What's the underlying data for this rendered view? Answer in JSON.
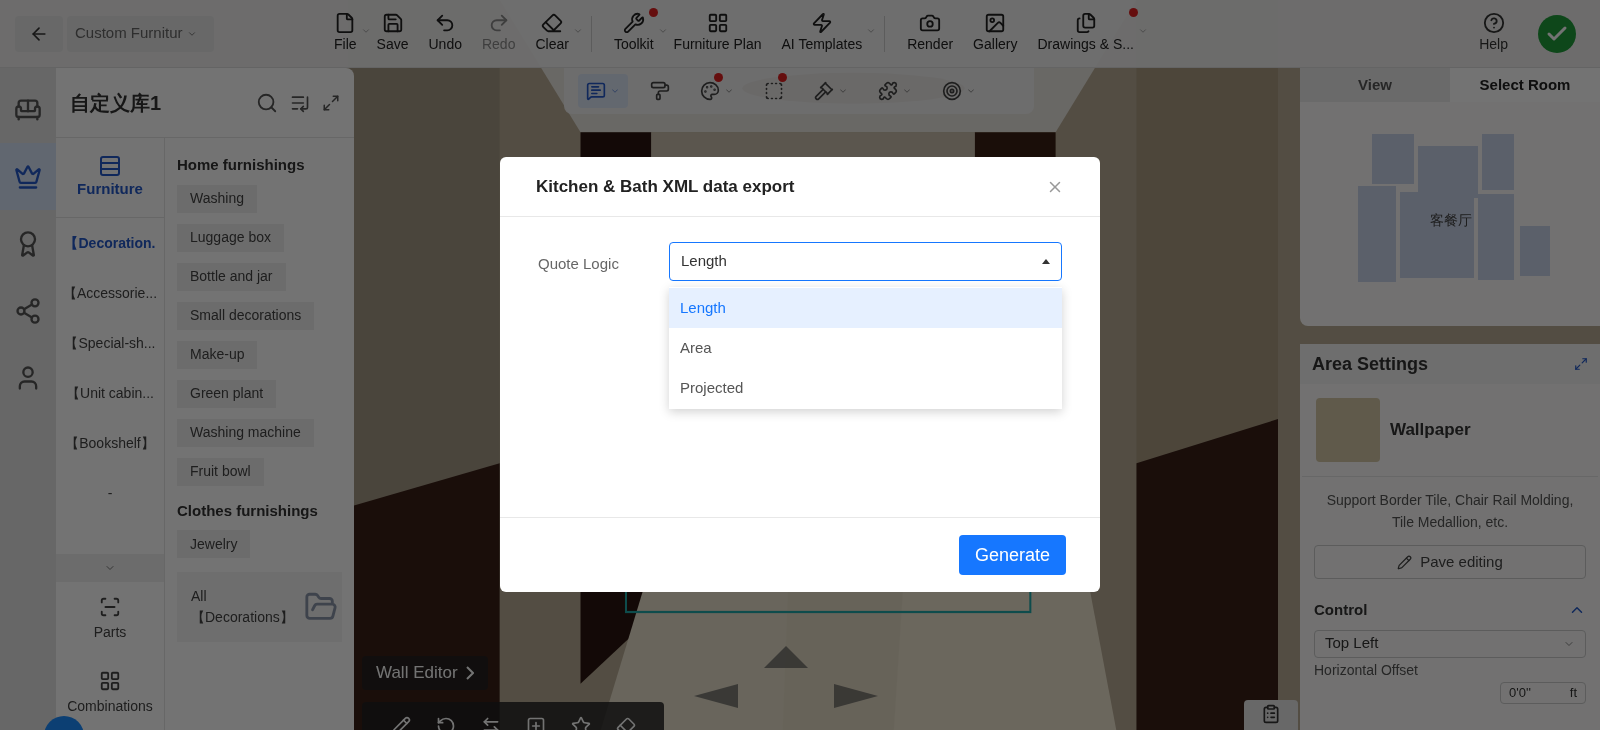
{
  "top_bar": {
    "project_name": "Custom Furnitur",
    "tool_groups": [
      [
        {
          "label": "File",
          "dropdown": true,
          "badge": false,
          "disabled": false
        },
        {
          "label": "Save",
          "dropdown": false,
          "badge": false,
          "disabled": false
        },
        {
          "label": "Undo",
          "dropdown": false,
          "badge": false,
          "disabled": false
        },
        {
          "label": "Redo",
          "dropdown": false,
          "badge": false,
          "disabled": true
        },
        {
          "label": "Clear",
          "dropdown": true,
          "badge": false,
          "disabled": false
        }
      ],
      [
        {
          "label": "Toolkit",
          "dropdown": true,
          "badge": true,
          "disabled": false
        },
        {
          "label": "Furniture Plan",
          "dropdown": false,
          "badge": false,
          "disabled": false
        },
        {
          "label": "AI Templates",
          "dropdown": true,
          "badge": false,
          "disabled": false
        }
      ],
      [
        {
          "label": "Render",
          "dropdown": false,
          "badge": false,
          "disabled": false
        },
        {
          "label": "Gallery",
          "dropdown": false,
          "badge": false,
          "disabled": false
        },
        {
          "label": "Drawings & S...",
          "dropdown": true,
          "badge": true,
          "disabled": false
        }
      ]
    ],
    "help": "Help"
  },
  "view_toolbar": [
    {
      "selected": true,
      "badge": false,
      "dropdown": true
    },
    {
      "selected": false,
      "badge": false,
      "dropdown": false
    },
    {
      "selected": false,
      "badge": true,
      "dropdown": true
    },
    {
      "selected": false,
      "badge": true,
      "dropdown": false
    },
    {
      "selected": false,
      "badge": false,
      "dropdown": true
    },
    {
      "selected": false,
      "badge": false,
      "dropdown": true
    },
    {
      "selected": false,
      "badge": false,
      "dropdown": true
    }
  ],
  "rail": [
    {
      "selected": false
    },
    {
      "selected": true
    },
    {
      "selected": false
    },
    {
      "selected": false
    },
    {
      "selected": false
    }
  ],
  "library": {
    "title": "自定义库1",
    "tab": {
      "label": "Furniture",
      "selected": true
    },
    "categories": [
      {
        "label": "【Decoration.",
        "selected": true
      },
      {
        "label": "【Accessorie...",
        "selected": false
      },
      {
        "label": "【Special-sh...",
        "selected": false
      },
      {
        "label": "【Unit cabin...",
        "selected": false
      },
      {
        "label": "【Bookshelf】",
        "selected": false
      },
      {
        "label": "-",
        "selected": false
      }
    ],
    "bottom_tabs": [
      "Parts",
      "Combinations"
    ],
    "groups": [
      {
        "title": "Home furnishings",
        "tags": [
          "Washing",
          "Luggage box",
          "Bottle and jar",
          "Small decorations",
          "Make-up",
          "Green plant",
          "Washing machine",
          "Fruit bowl"
        ]
      },
      {
        "title": "Clothes furnishings",
        "tags": [
          "Jewelry"
        ]
      }
    ],
    "all_card": [
      "All",
      "【Decorations】"
    ]
  },
  "scene": {
    "wall_editor": "Wall Editor"
  },
  "right_panel": {
    "tabs": [
      {
        "label": "View",
        "selected": false
      },
      {
        "label": "Select Room",
        "selected": true
      }
    ],
    "room_label": "客餐厅",
    "area_settings": {
      "title": "Area Settings",
      "material": "Wallpaper",
      "description": "Support Border Tile, Chair Rail Molding, Tile Medallion, etc.",
      "button": "Pave editing",
      "control": {
        "title": "Control",
        "expanded": true,
        "position": "Top Left",
        "offset_label": "Horizontal Offset",
        "offset_value": "0'0''",
        "offset_unit": "ft"
      }
    }
  },
  "dialog": {
    "title": "Kitchen & Bath XML data export",
    "field_label": "Quote Logic",
    "value": "Length",
    "options": [
      {
        "label": "Length",
        "selected": true
      },
      {
        "label": "Area",
        "selected": false
      },
      {
        "label": "Projected",
        "selected": false
      }
    ],
    "button": "Generate"
  }
}
